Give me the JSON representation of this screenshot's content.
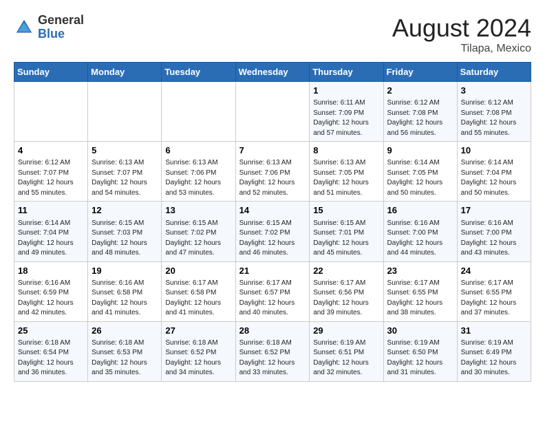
{
  "logo": {
    "general": "General",
    "blue": "Blue"
  },
  "title": "August 2024",
  "location": "Tilapa, Mexico",
  "days_of_week": [
    "Sunday",
    "Monday",
    "Tuesday",
    "Wednesday",
    "Thursday",
    "Friday",
    "Saturday"
  ],
  "weeks": [
    [
      {
        "day": "",
        "content": ""
      },
      {
        "day": "",
        "content": ""
      },
      {
        "day": "",
        "content": ""
      },
      {
        "day": "",
        "content": ""
      },
      {
        "day": "1",
        "content": "Sunrise: 6:11 AM\nSunset: 7:09 PM\nDaylight: 12 hours\nand 57 minutes."
      },
      {
        "day": "2",
        "content": "Sunrise: 6:12 AM\nSunset: 7:08 PM\nDaylight: 12 hours\nand 56 minutes."
      },
      {
        "day": "3",
        "content": "Sunrise: 6:12 AM\nSunset: 7:08 PM\nDaylight: 12 hours\nand 55 minutes."
      }
    ],
    [
      {
        "day": "4",
        "content": "Sunrise: 6:12 AM\nSunset: 7:07 PM\nDaylight: 12 hours\nand 55 minutes."
      },
      {
        "day": "5",
        "content": "Sunrise: 6:13 AM\nSunset: 7:07 PM\nDaylight: 12 hours\nand 54 minutes."
      },
      {
        "day": "6",
        "content": "Sunrise: 6:13 AM\nSunset: 7:06 PM\nDaylight: 12 hours\nand 53 minutes."
      },
      {
        "day": "7",
        "content": "Sunrise: 6:13 AM\nSunset: 7:06 PM\nDaylight: 12 hours\nand 52 minutes."
      },
      {
        "day": "8",
        "content": "Sunrise: 6:13 AM\nSunset: 7:05 PM\nDaylight: 12 hours\nand 51 minutes."
      },
      {
        "day": "9",
        "content": "Sunrise: 6:14 AM\nSunset: 7:05 PM\nDaylight: 12 hours\nand 50 minutes."
      },
      {
        "day": "10",
        "content": "Sunrise: 6:14 AM\nSunset: 7:04 PM\nDaylight: 12 hours\nand 50 minutes."
      }
    ],
    [
      {
        "day": "11",
        "content": "Sunrise: 6:14 AM\nSunset: 7:04 PM\nDaylight: 12 hours\nand 49 minutes."
      },
      {
        "day": "12",
        "content": "Sunrise: 6:15 AM\nSunset: 7:03 PM\nDaylight: 12 hours\nand 48 minutes."
      },
      {
        "day": "13",
        "content": "Sunrise: 6:15 AM\nSunset: 7:02 PM\nDaylight: 12 hours\nand 47 minutes."
      },
      {
        "day": "14",
        "content": "Sunrise: 6:15 AM\nSunset: 7:02 PM\nDaylight: 12 hours\nand 46 minutes."
      },
      {
        "day": "15",
        "content": "Sunrise: 6:15 AM\nSunset: 7:01 PM\nDaylight: 12 hours\nand 45 minutes."
      },
      {
        "day": "16",
        "content": "Sunrise: 6:16 AM\nSunset: 7:00 PM\nDaylight: 12 hours\nand 44 minutes."
      },
      {
        "day": "17",
        "content": "Sunrise: 6:16 AM\nSunset: 7:00 PM\nDaylight: 12 hours\nand 43 minutes."
      }
    ],
    [
      {
        "day": "18",
        "content": "Sunrise: 6:16 AM\nSunset: 6:59 PM\nDaylight: 12 hours\nand 42 minutes."
      },
      {
        "day": "19",
        "content": "Sunrise: 6:16 AM\nSunset: 6:58 PM\nDaylight: 12 hours\nand 41 minutes."
      },
      {
        "day": "20",
        "content": "Sunrise: 6:17 AM\nSunset: 6:58 PM\nDaylight: 12 hours\nand 41 minutes."
      },
      {
        "day": "21",
        "content": "Sunrise: 6:17 AM\nSunset: 6:57 PM\nDaylight: 12 hours\nand 40 minutes."
      },
      {
        "day": "22",
        "content": "Sunrise: 6:17 AM\nSunset: 6:56 PM\nDaylight: 12 hours\nand 39 minutes."
      },
      {
        "day": "23",
        "content": "Sunrise: 6:17 AM\nSunset: 6:55 PM\nDaylight: 12 hours\nand 38 minutes."
      },
      {
        "day": "24",
        "content": "Sunrise: 6:17 AM\nSunset: 6:55 PM\nDaylight: 12 hours\nand 37 minutes."
      }
    ],
    [
      {
        "day": "25",
        "content": "Sunrise: 6:18 AM\nSunset: 6:54 PM\nDaylight: 12 hours\nand 36 minutes."
      },
      {
        "day": "26",
        "content": "Sunrise: 6:18 AM\nSunset: 6:53 PM\nDaylight: 12 hours\nand 35 minutes."
      },
      {
        "day": "27",
        "content": "Sunrise: 6:18 AM\nSunset: 6:52 PM\nDaylight: 12 hours\nand 34 minutes."
      },
      {
        "day": "28",
        "content": "Sunrise: 6:18 AM\nSunset: 6:52 PM\nDaylight: 12 hours\nand 33 minutes."
      },
      {
        "day": "29",
        "content": "Sunrise: 6:19 AM\nSunset: 6:51 PM\nDaylight: 12 hours\nand 32 minutes."
      },
      {
        "day": "30",
        "content": "Sunrise: 6:19 AM\nSunset: 6:50 PM\nDaylight: 12 hours\nand 31 minutes."
      },
      {
        "day": "31",
        "content": "Sunrise: 6:19 AM\nSunset: 6:49 PM\nDaylight: 12 hours\nand 30 minutes."
      }
    ]
  ]
}
